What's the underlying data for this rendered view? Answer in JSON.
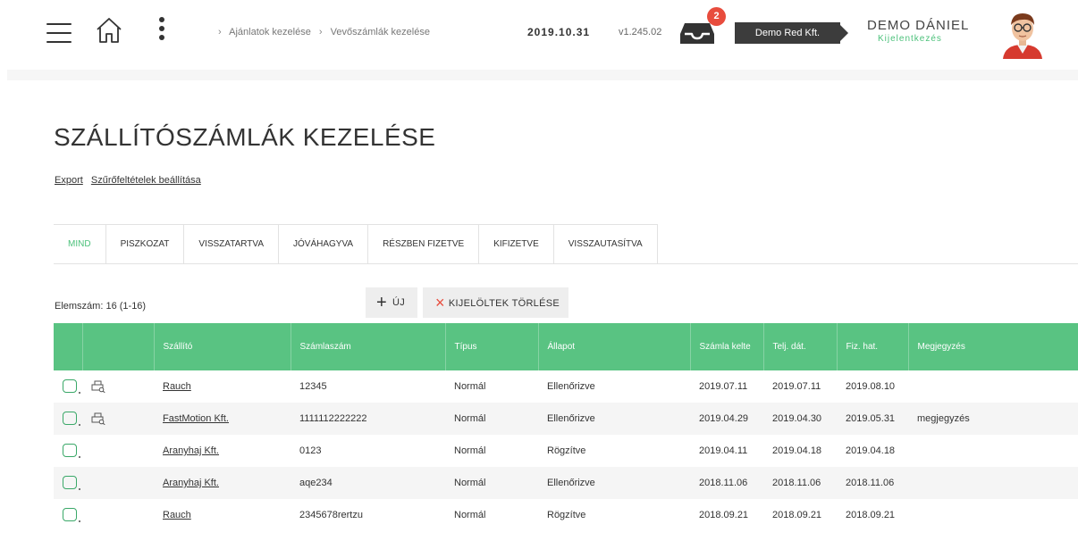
{
  "header": {
    "breadcrumb": [
      "Ajánlatok kezelése",
      "Vevőszámlák kezelése"
    ],
    "breadcrumb_separator": "›",
    "date": "2019.10.31",
    "version": "v1.245.02",
    "inbox_count": "2",
    "company": "Demo Red Kft.",
    "user_name": "DEMO DÁNIEL",
    "logout": "Kijelentkezés",
    "icons": [
      "menu-icon",
      "home-icon",
      "more-vertical-icon",
      "inbox-icon",
      "avatar"
    ]
  },
  "page": {
    "title": "SZÁLLÍTÓSZÁMLÁK KEZELÉSE",
    "links": [
      "Export",
      "Szűrőfeltételek beállítása"
    ]
  },
  "tabs": [
    {
      "label": "MIND",
      "active": true
    },
    {
      "label": "PISZKOZAT"
    },
    {
      "label": "VISSZATARTVA"
    },
    {
      "label": "JÓVÁHAGYVA"
    },
    {
      "label": "RÉSZBEN FIZETVE"
    },
    {
      "label": "KIFIZETVE"
    },
    {
      "label": "VISSZAUTASÍTVA"
    }
  ],
  "toolbar": {
    "count": "Elemszám: 16 (1-16)",
    "new_label": "ÚJ",
    "new_icon": "+",
    "delete_label": "KIJELÖLTEK TÖRLÉSE",
    "delete_icon": "×"
  },
  "table": {
    "columns": [
      "",
      "",
      "Szállító",
      "Számlaszám",
      "Típus",
      "Állapot",
      "Számla kelte",
      "Telj. dát.",
      "Fiz. hat.",
      "Megjegyzés"
    ],
    "rows": [
      {
        "print": true,
        "supplier": "Rauch",
        "number": "12345",
        "type": "Normál",
        "status": "Ellenőrizve",
        "issued": "2019.07.11",
        "fulfil": "2019.07.11",
        "due": "2019.08.10",
        "note": ""
      },
      {
        "print": true,
        "supplier": "FastMotion Kft.",
        "number": "1111112222222",
        "type": "Normál",
        "status": "Ellenőrizve",
        "issued": "2019.04.29",
        "fulfil": "2019.04.30",
        "due": "2019.05.31",
        "note": "megjegyzés"
      },
      {
        "print": false,
        "supplier": "Aranyhaj Kft.",
        "number": "0123",
        "type": "Normál",
        "status": "Rögzítve",
        "issued": "2019.04.11",
        "fulfil": "2019.04.18",
        "due": "2019.04.18",
        "note": ""
      },
      {
        "print": false,
        "supplier": "Aranyhaj Kft.",
        "number": "aqe234",
        "type": "Normál",
        "status": "Ellenőrizve",
        "issued": "2018.11.06",
        "fulfil": "2018.11.06",
        "due": "2018.11.06",
        "note": ""
      },
      {
        "print": false,
        "supplier": "Rauch",
        "number": "2345678rertzu",
        "type": "Normál",
        "status": "Rögzítve",
        "issued": "2018.09.21",
        "fulfil": "2018.09.21",
        "due": "2018.09.21",
        "note": ""
      }
    ]
  },
  "colors": {
    "accent": "#59c382",
    "accent_text": "#4cc17b",
    "badge": "#e84c3d",
    "company_bg": "#3c3c3c"
  }
}
